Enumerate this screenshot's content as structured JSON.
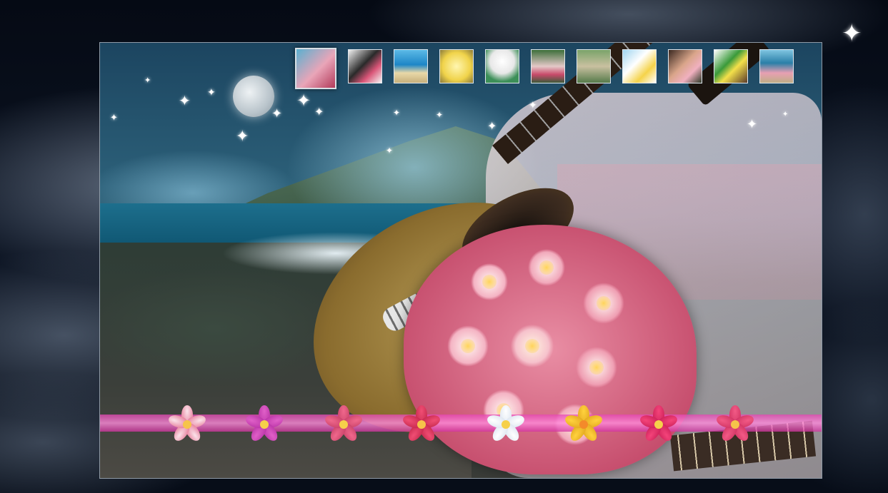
{
  "gallery": {
    "active_index": 0,
    "thumbnails": [
      {
        "name": "thumb-bouquet-beach",
        "bg": "linear-gradient(135deg,#5ab0d0,#e9a5b8 55%,#b23a5a)"
      },
      {
        "name": "thumb-couple-kiss-bouquet",
        "bg": "linear-gradient(135deg,#f0f0f0,#2a2a2a 45%,#d95577 70%,#f5f5f5)"
      },
      {
        "name": "thumb-beach-arch",
        "bg": "linear-gradient(180deg,#5bb9e6,#1d86c7 45%,#e8d8a8 70%,#c7b07c)"
      },
      {
        "name": "thumb-yellow-bouquet",
        "bg": "radial-gradient(circle at 50% 50%,#fff6b0,#f0d34a 60%,#8a7a3a)"
      },
      {
        "name": "thumb-bride-umbrella",
        "bg": "radial-gradient(circle at 50% 35%,#ffffff,#e8e8e8 45%,#3c8f58 75%)"
      },
      {
        "name": "thumb-bride-bouquet-garden",
        "bg": "linear-gradient(180deg,#3c6f3a,#e4c8c8 50%,#c84a6a 75%,#3c5a3a)"
      },
      {
        "name": "thumb-couple-walking",
        "bg": "linear-gradient(180deg,#7aa36a,#c9c0a0 50%,#567a4a)"
      },
      {
        "name": "thumb-couple-yellow-bouquet",
        "bg": "linear-gradient(135deg,#9fd4ef,#ffffff 40%,#f5d34a 70%,#ffffff)"
      },
      {
        "name": "thumb-bride-smiling",
        "bg": "linear-gradient(135deg,#3a2820,#d9a58a 45%,#f0b0c0 70%,#2f3a28)"
      },
      {
        "name": "thumb-couple-lei",
        "bg": "linear-gradient(135deg,#ffffff,#3a9a3a 40%,#f4e04a 60%,#5a3a2a)"
      },
      {
        "name": "thumb-bouquet-shore",
        "bg": "linear-gradient(180deg,#7fc4e0,#2a7fa8 40%,#e79fb2 70%,#bfae86)"
      }
    ]
  },
  "flower_bar": {
    "flowers": [
      {
        "name": "flower-pink-white",
        "petal": "#fbe3ea",
        "edge": "#e36d8e",
        "center": "#f6c44a"
      },
      {
        "name": "flower-magenta",
        "petal": "#e060c8",
        "edge": "#b42ea2",
        "center": "#f6d04a"
      },
      {
        "name": "flower-pink",
        "petal": "#f0688c",
        "edge": "#c43d64",
        "center": "#f6d04a"
      },
      {
        "name": "flower-deep-pink",
        "petal": "#f04e74",
        "edge": "#c12448",
        "center": "#f6c44a"
      },
      {
        "name": "flower-white",
        "petal": "#ffffff",
        "edge": "#d8e2ee",
        "center": "#f6d04a"
      },
      {
        "name": "flower-yellow",
        "petal": "#ffd23e",
        "edge": "#e0a21a",
        "center": "#f48a2a"
      },
      {
        "name": "flower-hot-pink",
        "petal": "#f4447a",
        "edge": "#c81c55",
        "center": "#f6d04a"
      },
      {
        "name": "flower-rose",
        "petal": "#f25a86",
        "edge": "#cc2f5e",
        "center": "#f6c44a"
      }
    ]
  },
  "colors": {
    "flower_bar": "#e24fb0",
    "frame_border": "#8f9aa6"
  }
}
